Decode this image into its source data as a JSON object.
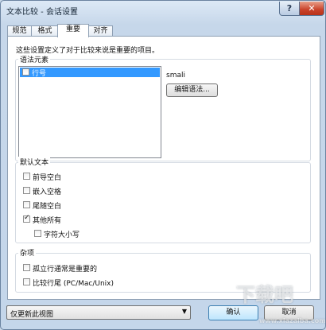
{
  "window": {
    "title": "文本比较 - 会话设置"
  },
  "titlebar": {
    "help_label": "?",
    "close_label": "✕"
  },
  "tabs": [
    {
      "label": "规范",
      "active": false
    },
    {
      "label": "格式",
      "active": false
    },
    {
      "label": "重要",
      "active": true
    },
    {
      "label": "对齐",
      "active": false
    }
  ],
  "panel": {
    "description": "这些设置定义了对于比较来说是重要的项目。"
  },
  "grammar": {
    "group_label": "语法元素",
    "list_items": [
      {
        "label": "行号",
        "checked": false,
        "selected": true
      }
    ],
    "grammar_name": "smali",
    "edit_button_label": "编辑语法..."
  },
  "default_text": {
    "group_label": "默认文本",
    "options": [
      {
        "label": "前导空白",
        "checked": false
      },
      {
        "label": "嵌入空格",
        "checked": false
      },
      {
        "label": "尾随空白",
        "checked": false
      },
      {
        "label": "其他所有",
        "checked": true
      },
      {
        "label": "字符大小写",
        "checked": false
      }
    ]
  },
  "misc": {
    "group_label": "杂项",
    "options": [
      {
        "label": "孤立行通常是重要的",
        "checked": false
      },
      {
        "label": "比较行尾 (PC/Mac/Unix)",
        "checked": false
      }
    ]
  },
  "footer": {
    "scope_select_value": "仅更新此视图",
    "ok_label": "确认",
    "cancel_label": "取消"
  },
  "watermark": {
    "text": "下载吧",
    "url": "www.xiazaiba.com"
  }
}
